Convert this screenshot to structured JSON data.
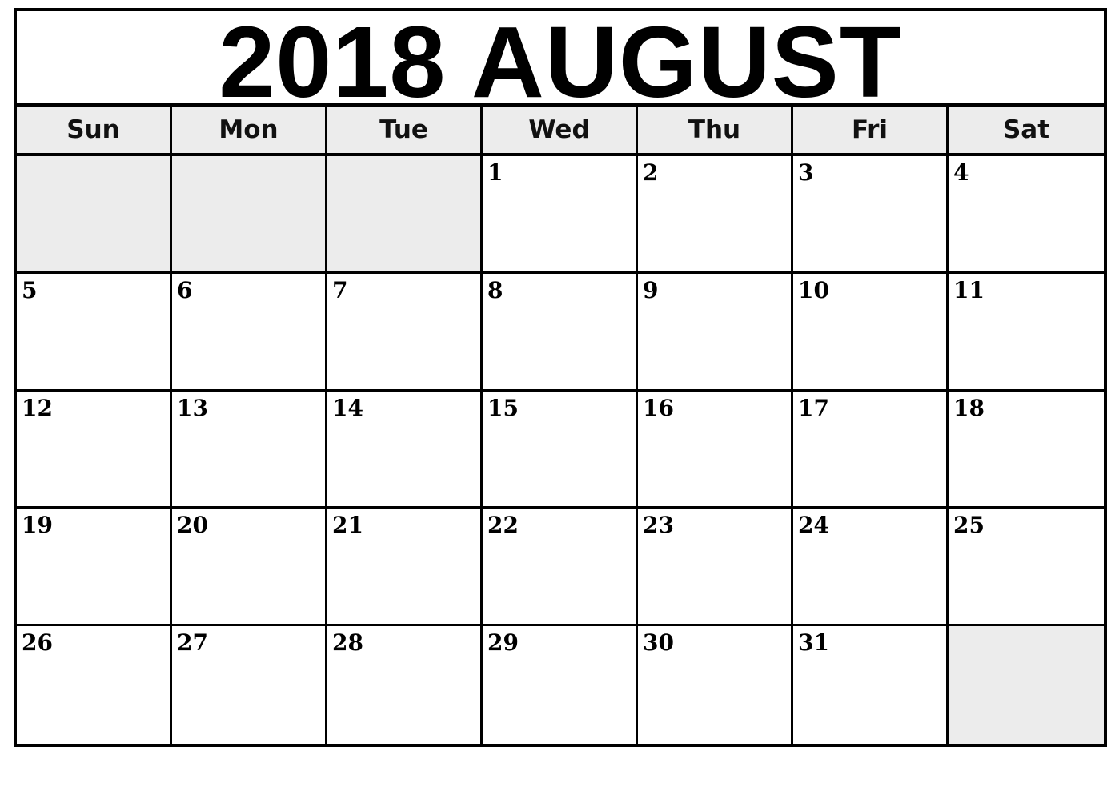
{
  "calendar": {
    "title": "2018 AUGUST",
    "year": 2018,
    "month": "AUGUST",
    "weekdays": [
      "Sun",
      "Mon",
      "Tue",
      "Wed",
      "Thu",
      "Fri",
      "Sat"
    ],
    "weeks": [
      [
        "",
        "",
        "",
        "1",
        "2",
        "3",
        "4"
      ],
      [
        "5",
        "6",
        "7",
        "8",
        "9",
        "10",
        "11"
      ],
      [
        "12",
        "13",
        "14",
        "15",
        "16",
        "17",
        "18"
      ],
      [
        "19",
        "20",
        "21",
        "22",
        "23",
        "24",
        "25"
      ],
      [
        "26",
        "27",
        "28",
        "29",
        "30",
        "31",
        ""
      ]
    ],
    "shaded_empty_cells": [
      [
        0,
        0
      ],
      [
        4,
        6
      ]
    ],
    "colors": {
      "border": "#000000",
      "header_bg": "#ececec",
      "empty_bg": "#ececec",
      "cell_bg": "#ffffff"
    }
  }
}
